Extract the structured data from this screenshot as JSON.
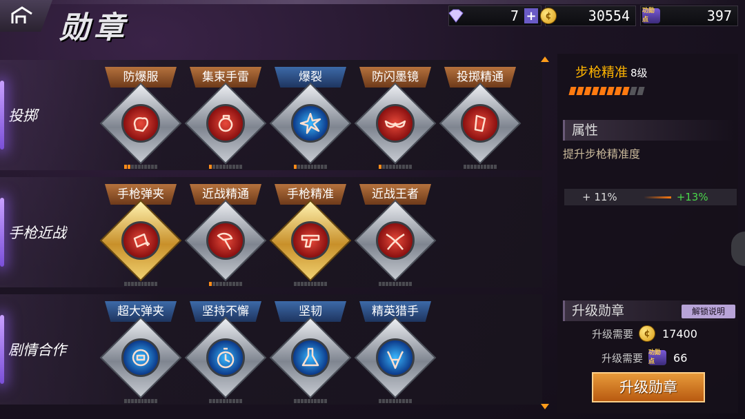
{
  "header": {
    "title": "勋章",
    "diamonds": "7",
    "gold": "30554",
    "merit": "397",
    "merit_icon_text": "功勋点"
  },
  "rows": [
    {
      "label": "投掷",
      "medals": [
        {
          "name": "防爆服",
          "style": "red",
          "frame": "silver",
          "icon": "fist-icon",
          "level": 2
        },
        {
          "name": "集束手雷",
          "style": "red",
          "frame": "silver",
          "icon": "grenade-icon",
          "level": 1
        },
        {
          "name": "爆裂",
          "style": "blue",
          "frame": "silver",
          "icon": "explosion-icon",
          "level": 1
        },
        {
          "name": "防闪墨镜",
          "style": "red",
          "frame": "silver",
          "icon": "sunglasses-icon",
          "level": 1
        },
        {
          "name": "投掷精通",
          "style": "red",
          "frame": "silver",
          "icon": "throw-icon",
          "level": 0
        }
      ]
    },
    {
      "label": "手枪近战",
      "medals": [
        {
          "name": "手枪弹夹",
          "style": "red",
          "frame": "gold",
          "icon": "magazine-icon",
          "level": 0
        },
        {
          "name": "近战精通",
          "style": "red",
          "frame": "silver",
          "icon": "axe-icon",
          "level": 1
        },
        {
          "name": "手枪精准",
          "style": "red",
          "frame": "gold",
          "icon": "pistol-icon",
          "level": 0
        },
        {
          "name": "近战王者",
          "style": "red",
          "frame": "silver",
          "icon": "crossed-blades-icon",
          "level": 0
        }
      ]
    },
    {
      "label": "剧情合作",
      "medals": [
        {
          "name": "超大弹夹",
          "style": "blue",
          "frame": "silver",
          "icon": "ammo-drum-icon",
          "level": 0
        },
        {
          "name": "坚持不懈",
          "style": "blue",
          "frame": "silver",
          "icon": "stopwatch-icon",
          "level": 0
        },
        {
          "name": "坚韧",
          "style": "blue",
          "frame": "silver",
          "icon": "flask-icon",
          "level": 0
        },
        {
          "name": "精英猎手",
          "style": "blue",
          "frame": "silver",
          "icon": "viking-icon",
          "level": 0
        }
      ]
    }
  ],
  "selected": {
    "name": "步枪精准",
    "level": "8级",
    "progress_segments": 10,
    "progress_filled": 8
  },
  "attribute": {
    "heading": "属性",
    "description": "提升步枪精准度",
    "current": "+ 11%",
    "next": "+13%"
  },
  "upgrade": {
    "heading": "升级勋章",
    "unlock_label": "解锁说明",
    "req_gold_label": "升级需要",
    "req_gold_value": "17400",
    "req_merit_label": "升级需要",
    "req_merit_value": "66",
    "button_label": "升级勋章"
  },
  "colors": {
    "accent": "#ff9c1a",
    "gold_name": "#ffb400",
    "next_value": "#4ad84a"
  }
}
